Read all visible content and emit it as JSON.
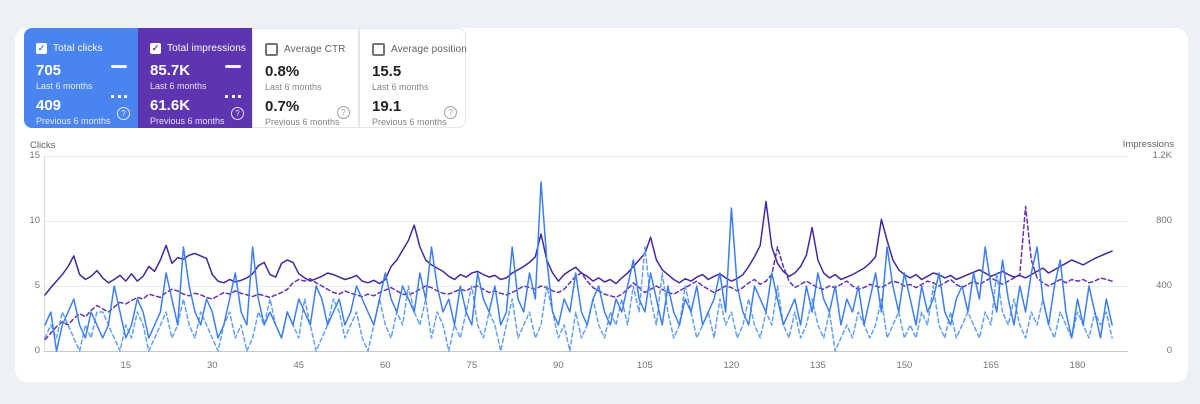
{
  "page": {
    "background": "#edf0f4",
    "panel_background": "#ffffff"
  },
  "cards": [
    {
      "label": "Total clicks",
      "checked": true,
      "background": "#4a84ee",
      "text_color": "#ffffff",
      "value_last": "705",
      "caption_last": "Last 6 months",
      "value_prev": "409",
      "caption_prev": "Previous 6 months",
      "help_glyph": "?"
    },
    {
      "label": "Total impressions",
      "checked": true,
      "background": "#5e35b1",
      "text_color": "#ffffff",
      "value_last": "85.7K",
      "caption_last": "Last 6 months",
      "value_prev": "61.6K",
      "caption_prev": "Previous 6 months",
      "help_glyph": "?"
    },
    {
      "label": "Average CTR",
      "checked": false,
      "background": "#ffffff",
      "text_color": "#202124",
      "value_last": "0.8%",
      "caption_last": "Last 6 months",
      "value_prev": "0.7%",
      "caption_prev": "Previous 6 months",
      "help_glyph": "?"
    },
    {
      "label": "Average position",
      "checked": false,
      "background": "#ffffff",
      "text_color": "#202124",
      "value_last": "15.5",
      "caption_last": "Last 6 months",
      "value_prev": "19.1",
      "caption_prev": "Previous 6 months",
      "help_glyph": "?"
    }
  ],
  "checkbox_mark": "✓",
  "chart_data": {
    "type": "line",
    "title": "",
    "x_ticks": [
      15,
      30,
      45,
      60,
      75,
      90,
      105,
      120,
      135,
      150,
      165,
      180
    ],
    "x_range": [
      1,
      186
    ],
    "left_axis": {
      "label": "Clicks",
      "ticks": [
        "15",
        "10",
        "5",
        "0"
      ],
      "max": 15
    },
    "right_axis": {
      "label": "Impressions",
      "ticks": [
        "1.2K",
        "800",
        "400",
        "0"
      ],
      "max": 1200
    },
    "grid": "horizontal",
    "legend_position": "cards-top",
    "series": [
      {
        "name": "Clicks — Last 6 months",
        "axis": "left",
        "style": "solid",
        "color": "#3d7ef2",
        "values": [
          2,
          3,
          0,
          2,
          3,
          4,
          2,
          1,
          3,
          2,
          1,
          2,
          5,
          3,
          1,
          2,
          4,
          3,
          1,
          2,
          3,
          6,
          4,
          2,
          8,
          5,
          3,
          2,
          4,
          3,
          1,
          2,
          4,
          6,
          3,
          2,
          8,
          4,
          2,
          3,
          2,
          1,
          3,
          2,
          4,
          3,
          2,
          5,
          4,
          2,
          3,
          4,
          2,
          3,
          5,
          4,
          3,
          2,
          4,
          6,
          4,
          3,
          5,
          4,
          3,
          6,
          4,
          8,
          5,
          3,
          4,
          2,
          5,
          3,
          2,
          6,
          4,
          3,
          5,
          2,
          3,
          8,
          4,
          3,
          6,
          4,
          13,
          7,
          3,
          2,
          4,
          3,
          6,
          3,
          2,
          4,
          5,
          3,
          2,
          4,
          3,
          5,
          7,
          4,
          3,
          6,
          4,
          2,
          5,
          3,
          2,
          4,
          3,
          5,
          2,
          3,
          4,
          6,
          3,
          11,
          5,
          3,
          2,
          5,
          4,
          3,
          6,
          4,
          2,
          3,
          4,
          2,
          5,
          3,
          6,
          4,
          3,
          5,
          2,
          4,
          3,
          5,
          2,
          4,
          6,
          3,
          8,
          5,
          3,
          6,
          4,
          2,
          5,
          3,
          4,
          6,
          3,
          2,
          4,
          5,
          3,
          6,
          4,
          8,
          5,
          3,
          7,
          4,
          2,
          5,
          3,
          6,
          8,
          4,
          2,
          5,
          7,
          3,
          1,
          4,
          2,
          5,
          3,
          1,
          4,
          2
        ]
      },
      {
        "name": "Clicks — Previous 6 months",
        "axis": "left",
        "style": "dashed",
        "color": "#64a0f6",
        "values": [
          1,
          2,
          1,
          3,
          2,
          1,
          0,
          2,
          1,
          3,
          3,
          2,
          1,
          0,
          2,
          1,
          3,
          2,
          0,
          1,
          2,
          3,
          1,
          2,
          4,
          2,
          1,
          3,
          2,
          1,
          0,
          2,
          3,
          1,
          2,
          0,
          1,
          3,
          2,
          4,
          2,
          1,
          3,
          2,
          1,
          4,
          2,
          0,
          1,
          2,
          4,
          3,
          1,
          2,
          3,
          1,
          0,
          2,
          4,
          2,
          1,
          3,
          2,
          5,
          3,
          2,
          4,
          1,
          3,
          2,
          0,
          2,
          1,
          3,
          5,
          2,
          1,
          3,
          2,
          0,
          2,
          4,
          1,
          2,
          3,
          1,
          2,
          5,
          3,
          1,
          2,
          0,
          3,
          1,
          2,
          4,
          2,
          1,
          3,
          2,
          4,
          2,
          5,
          3,
          8,
          4,
          2,
          6,
          3,
          1,
          2,
          5,
          3,
          1,
          2,
          3,
          1,
          4,
          2,
          3,
          1,
          2,
          4,
          2,
          1,
          3,
          2,
          5,
          2,
          1,
          3,
          1,
          2,
          4,
          2,
          1,
          3,
          0,
          1,
          2,
          1,
          3,
          2,
          1,
          2,
          4,
          1,
          2,
          3,
          1,
          2,
          1,
          3,
          2,
          5,
          2,
          1,
          3,
          1,
          2,
          3,
          2,
          1,
          3,
          2,
          6,
          3,
          2,
          4,
          2,
          1,
          3,
          2,
          4,
          2,
          1,
          3,
          2,
          1,
          3,
          2,
          1,
          3,
          2,
          3,
          1
        ]
      },
      {
        "name": "Impressions — Last 6 months",
        "axis": "right",
        "style": "solid",
        "color": "#44289d",
        "values": [
          345,
          390,
          430,
          470,
          520,
          585,
          470,
          440,
          460,
          495,
          450,
          420,
          440,
          465,
          430,
          475,
          430,
          460,
          520,
          490,
          560,
          650,
          540,
          575,
          565,
          590,
          600,
          585,
          570,
          470,
          430,
          420,
          440,
          425,
          435,
          450,
          475,
          525,
          545,
          470,
          455,
          540,
          560,
          545,
          475,
          450,
          430,
          445,
          460,
          480,
          470,
          455,
          440,
          450,
          465,
          430,
          420,
          435,
          415,
          440,
          520,
          560,
          620,
          680,
          775,
          640,
          560,
          530,
          510,
          490,
          460,
          440,
          470,
          455,
          480,
          490,
          470,
          455,
          465,
          440,
          450,
          480,
          500,
          520,
          545,
          580,
          720,
          560,
          480,
          430,
          470,
          495,
          515,
          480,
          460,
          430,
          450,
          425,
          440,
          415,
          450,
          480,
          520,
          560,
          600,
          700,
          560,
          500,
          470,
          440,
          420,
          445,
          430,
          455,
          470,
          440,
          460,
          475,
          450,
          430,
          445,
          470,
          520,
          580,
          650,
          920,
          640,
          540,
          490,
          460,
          480,
          520,
          590,
          760,
          560,
          480,
          450,
          470,
          440,
          455,
          470,
          490,
          510,
          540,
          580,
          810,
          680,
          560,
          500,
          470,
          450,
          470,
          440,
          460,
          480,
          470,
          450,
          465,
          440,
          455,
          470,
          485,
          500,
          480,
          460,
          475,
          490,
          470,
          455,
          465,
          450,
          470,
          490,
          510,
          480,
          500,
          520,
          540,
          560,
          545,
          530,
          550,
          570,
          585,
          600,
          615
        ]
      },
      {
        "name": "Impressions — Previous 6 months",
        "axis": "right",
        "style": "dashed",
        "color": "#6233b4",
        "values": [
          70,
          110,
          150,
          180,
          160,
          200,
          230,
          210,
          250,
          280,
          260,
          240,
          270,
          300,
          290,
          310,
          330,
          320,
          350,
          340,
          330,
          360,
          380,
          370,
          350,
          340,
          355,
          345,
          330,
          320,
          340,
          360,
          350,
          370,
          355,
          345,
          335,
          350,
          340,
          330,
          345,
          360,
          380,
          420,
          440,
          430,
          445,
          420,
          400,
          380,
          360,
          350,
          370,
          355,
          345,
          335,
          350,
          340,
          360,
          375,
          390,
          370,
          350,
          345,
          360,
          380,
          400,
          390,
          370,
          355,
          350,
          365,
          380,
          370,
          390,
          400,
          380,
          360,
          370,
          355,
          345,
          360,
          380,
          400,
          390,
          380,
          400,
          390,
          370,
          360,
          380,
          420,
          460,
          480,
          430,
          390,
          370,
          350,
          340,
          330,
          350,
          380,
          420,
          390,
          360,
          380,
          400,
          380,
          360,
          350,
          370,
          390,
          410,
          430,
          400,
          380,
          360,
          380,
          400,
          390,
          370,
          390,
          420,
          440,
          410,
          430,
          470,
          640,
          520,
          430,
          390,
          410,
          430,
          410,
          390,
          380,
          400,
          390,
          410,
          430,
          400,
          380,
          390,
          410,
          400,
          390,
          410,
          430,
          420,
          400,
          410,
          390,
          410,
          430,
          420,
          400,
          420,
          440,
          410,
          390,
          410,
          430,
          410,
          430,
          450,
          430,
          410,
          430,
          450,
          470,
          890,
          560,
          450,
          420,
          400,
          420,
          440,
          420,
          440,
          430,
          440,
          420,
          430,
          450,
          440,
          430
        ]
      }
    ]
  }
}
